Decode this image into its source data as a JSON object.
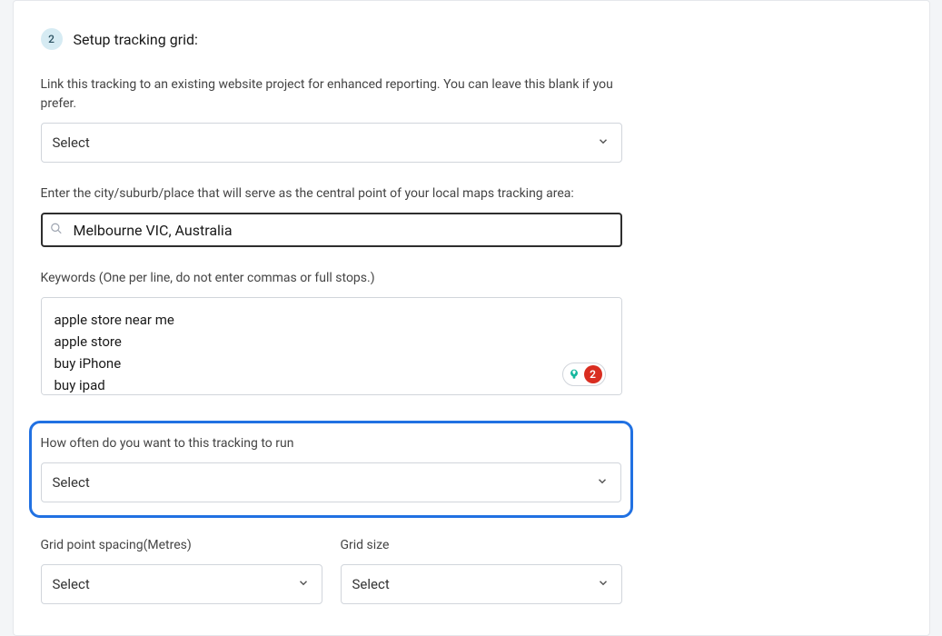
{
  "step": {
    "number": "2",
    "title": "Setup tracking grid:"
  },
  "project": {
    "label": "Link this tracking to an existing website project for enhanced reporting. You can leave this blank if you prefer.",
    "placeholder": "Select"
  },
  "location": {
    "label": "Enter the city/suburb/place that will serve as the central point of your local maps tracking area:",
    "value": "Melbourne VIC, Australia"
  },
  "keywords": {
    "label": "Keywords (One per line, do not enter commas or full stops.)",
    "value": "apple store near me\napple store\nbuy iPhone\nbuy ipad",
    "badge": "2"
  },
  "frequency": {
    "label": "How often do you want to this tracking to run",
    "placeholder": "Select"
  },
  "spacing": {
    "label": "Grid point spacing(Metres)",
    "placeholder": "Select"
  },
  "gridsize": {
    "label": "Grid size",
    "placeholder": "Select"
  }
}
